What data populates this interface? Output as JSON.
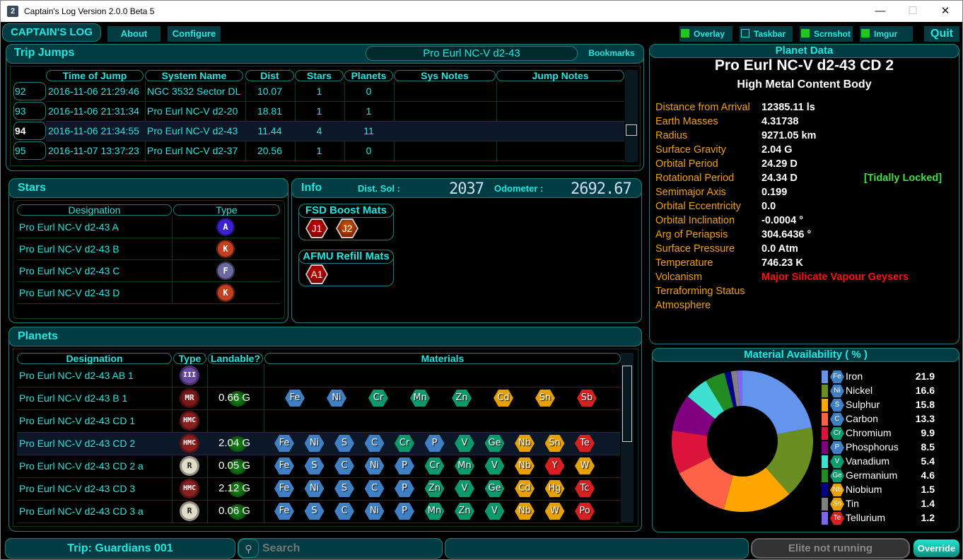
{
  "window": {
    "title": "Captain's Log Version 2.0.0 Beta 5",
    "app_icon": "2",
    "controls": {
      "minimize": "—",
      "maximize": "☐",
      "close": "✕"
    }
  },
  "header": {
    "logo": "CAPTAIN'S LOG",
    "about": "About",
    "configure": "Configure",
    "toggles": [
      {
        "label": "Overlay",
        "checked": true
      },
      {
        "label": "Taskbar",
        "checked": false
      },
      {
        "label": "Scrnshot",
        "checked": true
      },
      {
        "label": "Imgur",
        "checked": true
      }
    ],
    "quit": "Quit"
  },
  "trip_jumps": {
    "title": "Trip Jumps",
    "current_system": "Pro Eurl NC-V d2-43",
    "bookmarks": "Bookmarks",
    "columns": [
      "Time of Jump",
      "System Name",
      "Dist",
      "Stars",
      "Planets",
      "Sys Notes",
      "Jump Notes"
    ],
    "rows": [
      {
        "num": "92",
        "time": "2016-11-06 21:29:46",
        "system": "NGC 3532 Sector DL",
        "dist": "10.07",
        "stars": "1",
        "planets": "0",
        "sys_notes": "",
        "jump_notes": ""
      },
      {
        "num": "93",
        "time": "2016-11-06 21:31:34",
        "system": "Pro Eurl NC-V d2-20",
        "dist": "18.81",
        "stars": "1",
        "planets": "1",
        "sys_notes": "",
        "jump_notes": ""
      },
      {
        "num": "94",
        "time": "2016-11-06 21:34:55",
        "system": "Pro Eurl NC-V d2-43",
        "dist": "11.44",
        "stars": "4",
        "planets": "11",
        "sys_notes": "",
        "jump_notes": "",
        "selected": true
      },
      {
        "num": "95",
        "time": "2016-11-07 13:37:23",
        "system": "Pro Eurl NC-V d2-37",
        "dist": "20.56",
        "stars": "1",
        "planets": "0",
        "sys_notes": "",
        "jump_notes": ""
      }
    ]
  },
  "stars": {
    "title": "Stars",
    "columns": [
      "Designation",
      "Type"
    ],
    "rows": [
      {
        "name": "Pro Eurl NC-V d2-43 A",
        "type": "A",
        "color": "#3a22d0"
      },
      {
        "name": "Pro Eurl NC-V d2-43 B",
        "type": "K",
        "color": "#c04020"
      },
      {
        "name": "Pro Eurl NC-V d2-43 C",
        "type": "F",
        "color": "#6a6aa0"
      },
      {
        "name": "Pro Eurl NC-V d2-43 D",
        "type": "K",
        "color": "#c04020"
      }
    ]
  },
  "info": {
    "title": "Info",
    "dist_sol_label": "Dist. Sol :",
    "dist_sol_value": "2037",
    "odometer_label": "Odometer :",
    "odometer_value": "2692.67",
    "fsd_title": "FSD Boost Mats",
    "fsd_mats": [
      {
        "label": "J1",
        "color": "#b80000"
      },
      {
        "label": "J2",
        "color": "#b84a00"
      }
    ],
    "afmu_title": "AFMU Refill Mats",
    "afmu_mats": [
      {
        "label": "A1",
        "color": "#b80000"
      }
    ]
  },
  "planets": {
    "title": "Planets",
    "columns": [
      "Designation",
      "Type",
      "Landable?",
      "Materials"
    ],
    "rows": [
      {
        "name": "Pro Eurl NC-V d2-43 AB 1",
        "type": "III",
        "type_color": "#6a4aa0",
        "gravity": "",
        "materials": []
      },
      {
        "name": "Pro Eurl NC-V d2-43 B 1",
        "type": "MR",
        "type_color": "#7a1818",
        "gravity": "0.66",
        "materials": [
          "Fe",
          "Ni",
          "Cr",
          "Mn",
          "Zn",
          "Cd",
          "Sn",
          "Sb"
        ],
        "spread": true
      },
      {
        "name": "Pro Eurl NC-V d2-43 CD 1",
        "type": "HMC",
        "type_color": "#8a2020",
        "gravity": "",
        "materials": []
      },
      {
        "name": "Pro Eurl NC-V d2-43 CD 2",
        "type": "HMC",
        "type_color": "#8a2020",
        "gravity": "2.04",
        "materials": [
          "Fe",
          "Ni",
          "S",
          "C",
          "Cr",
          "P",
          "V",
          "Ge",
          "Nb",
          "Sn",
          "Te"
        ],
        "selected": true
      },
      {
        "name": "Pro Eurl NC-V d2-43 CD 2 a",
        "type": "R",
        "type_color": "#e0dcc8",
        "gravity": "0.05",
        "materials": [
          "Fe",
          "S",
          "C",
          "Ni",
          "P",
          "Cr",
          "Mn",
          "V",
          "Nb",
          "Y",
          "W"
        ]
      },
      {
        "name": "Pro Eurl NC-V d2-43 CD 3",
        "type": "HMC",
        "type_color": "#8a2020",
        "gravity": "2.12",
        "materials": [
          "Fe",
          "Ni",
          "S",
          "C",
          "P",
          "Zn",
          "V",
          "Ge",
          "Cd",
          "Hg",
          "Tc"
        ]
      },
      {
        "name": "Pro Eurl NC-V d2-43 CD 3 a",
        "type": "R",
        "type_color": "#e0dcc8",
        "gravity": "0.06",
        "materials": [
          "Fe",
          "S",
          "C",
          "Ni",
          "P",
          "Mn",
          "Zn",
          "V",
          "Nb",
          "W",
          "Po"
        ]
      }
    ],
    "gravity_unit": "G"
  },
  "material_colors": {
    "Fe": "blue",
    "Ni": "blue",
    "S": "blue",
    "C": "blue",
    "P": "blue",
    "Cr": "green",
    "Mn": "green",
    "Zn": "green",
    "V": "green",
    "Ge": "green",
    "Cd": "orange",
    "Sn": "orange",
    "Nb": "orange",
    "W": "orange",
    "Hg": "orange",
    "Sb": "red",
    "Te": "red",
    "Y": "red",
    "Tc": "red",
    "Po": "red"
  },
  "planet_data": {
    "title": "Planet Data",
    "name": "Pro Eurl NC-V d2-43 CD 2",
    "body_type": "High Metal Content Body",
    "properties": [
      {
        "label": "Distance from Arrival",
        "value": "12385.11 ls"
      },
      {
        "label": "Earth Masses",
        "value": "4.31738"
      },
      {
        "label": "Radius",
        "value": "9271.05 km"
      },
      {
        "label": "Surface Gravity",
        "value": "2.04 G"
      },
      {
        "label": "Orbital Period",
        "value": "24.29 D"
      },
      {
        "label": "Rotational  Period",
        "value": "24.34 D",
        "note": "[Tidally Locked]"
      },
      {
        "label": "Semimajor Axis",
        "value": "0.199"
      },
      {
        "label": "Orbital Eccentricity",
        "value": "0.0"
      },
      {
        "label": "Orbital Inclination",
        "value": "-0.0004 °"
      },
      {
        "label": "Arg of Periapsis",
        "value": "304.6436 °"
      },
      {
        "label": "Surface Pressure",
        "value": "0.0 Atm"
      },
      {
        "label": "Temperature",
        "value": "746.23 K"
      },
      {
        "label": "Volcanism",
        "value": "Major Silicate Vapour Geysers",
        "alert": true
      },
      {
        "label": "Terraforming Status",
        "value": ""
      },
      {
        "label": "Atmosphere",
        "value": ""
      }
    ],
    "note_color": "#3ee03e",
    "alert_color": "#ff1010"
  },
  "chart_data": {
    "type": "pie",
    "title": "Material Availability ( % )",
    "donut": true,
    "categories": [
      "Iron",
      "Nickel",
      "Sulphur",
      "Carbon",
      "Chromium",
      "Phosphorus",
      "Vanadium",
      "Germanium",
      "Niobium",
      "Tin",
      "Tellurium"
    ],
    "symbols": [
      "Fe",
      "Ni",
      "S",
      "C",
      "Cr",
      "P",
      "V",
      "Ge",
      "Nb",
      "Sn",
      "Te"
    ],
    "values": [
      21.9,
      16.6,
      15.8,
      13.3,
      9.9,
      8.5,
      5.4,
      4.6,
      1.5,
      1.4,
      1.2
    ],
    "colors": [
      "#6495ed",
      "#6b8e23",
      "#ffa500",
      "#ff6347",
      "#dc143c",
      "#800080",
      "#40e0d0",
      "#228b22",
      "#00008b",
      "#808080",
      "#7b68ee"
    ],
    "legend": "right"
  },
  "footer": {
    "trip": "Trip: Guardians 001",
    "search_placeholder": "Search",
    "status_field": "",
    "elite_status": "Elite not running",
    "override": "Override"
  }
}
